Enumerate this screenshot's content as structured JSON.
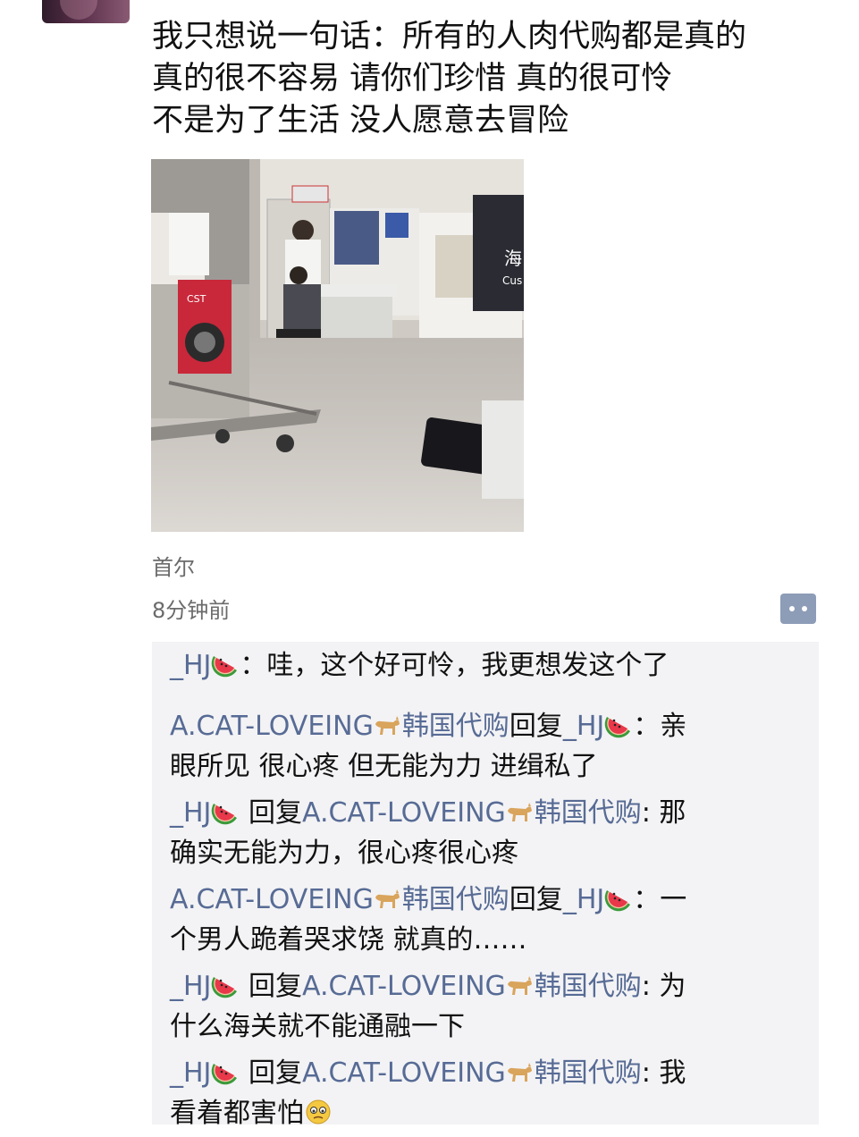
{
  "post": {
    "text_lines": [
      "我只想说一句话：所有的人肉代购都是真的",
      "真的很不容易 请你们珍惜 真的很可怜",
      "不是为了生活 没人愿意去冒险"
    ],
    "location": "首尔",
    "time": "8分钟前"
  },
  "photo_signs": {
    "trolley_brand": "CST",
    "customs_sign": "海",
    "customs_sign_en": "Cus"
  },
  "comments": [
    {
      "author": "_HJ",
      "author_icon": "watermelon-icon",
      "reply_word": "",
      "target": "",
      "target_icon": "",
      "target_suffix": "",
      "sep": "：",
      "line1": "哇，这个好可怜，我更想发这个了",
      "line2": ""
    },
    {
      "author": "A.CAT-LOVEING",
      "author_icon": "cat-icon",
      "author_suffix": "韩国代购",
      "reply_word": "回复",
      "target": "_HJ",
      "target_icon": "watermelon-icon",
      "target_suffix": "",
      "sep": "：",
      "line1": "亲",
      "line2": "眼所见 很心疼 但无能为力 进缉私了"
    },
    {
      "author": "_HJ",
      "author_icon": "watermelon-icon",
      "reply_word": " 回复",
      "target": "A.CAT-LOVEING",
      "target_icon": "cat-icon",
      "target_suffix": "韩国代购",
      "sep": ": ",
      "line1": "那",
      "line2": "确实无能为力，很心疼很心疼"
    },
    {
      "author": "A.CAT-LOVEING",
      "author_icon": "cat-icon",
      "author_suffix": "韩国代购",
      "reply_word": "回复",
      "target": "_HJ",
      "target_icon": "watermelon-icon",
      "target_suffix": "",
      "sep": "：",
      "line1": "一",
      "line2": "个男人跪着哭求饶 就真的……"
    },
    {
      "author": "_HJ",
      "author_icon": "watermelon-icon",
      "reply_word": " 回复",
      "target": "A.CAT-LOVEING",
      "target_icon": "cat-icon",
      "target_suffix": "韩国代购",
      "sep": ": ",
      "line1": "为",
      "line2": "什么海关就不能通融一下"
    },
    {
      "author": "_HJ",
      "author_icon": "watermelon-icon",
      "reply_word": " 回复",
      "target": "A.CAT-LOVEING",
      "target_icon": "cat-icon",
      "target_suffix": "韩国代购",
      "sep": ": ",
      "line1": "我",
      "line2": "看着都害怕",
      "line2_icon": "worried-face-icon"
    }
  ],
  "colors": {
    "nickname": "#576b95",
    "comment_bg": "#f3f3f5",
    "meta_text": "#6b6b6b"
  }
}
